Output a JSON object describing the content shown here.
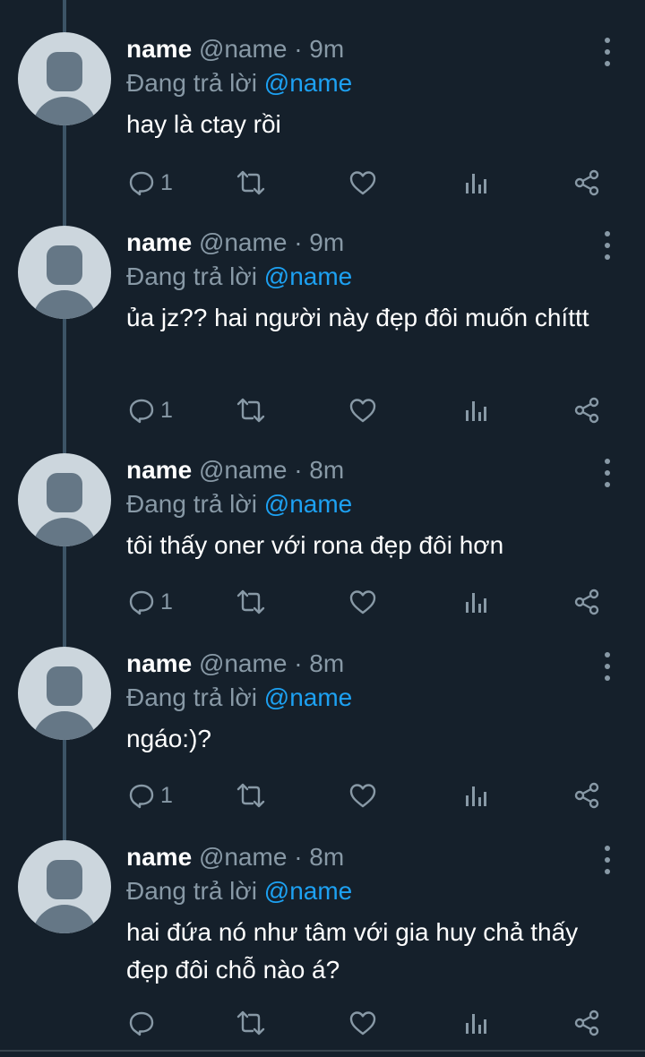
{
  "tweets": [
    {
      "display_name": "name",
      "handle": "@name",
      "separator": "·",
      "time": "9m",
      "reply_prefix": "Đang trả lời",
      "reply_to": "@name",
      "text": "hay là ctay rồi",
      "reply_count": "1",
      "icons": [
        "reply-icon",
        "retweet-icon",
        "like-icon",
        "analytics-icon",
        "share-icon",
        "more-icon"
      ]
    },
    {
      "display_name": "name",
      "handle": "@name",
      "separator": "·",
      "time": "9m",
      "reply_prefix": "Đang trả lời",
      "reply_to": "@name",
      "text": "ủa jz?? hai người này đẹp đôi muốn chíttt",
      "reply_count": "1"
    },
    {
      "display_name": "name",
      "handle": "@name",
      "separator": "·",
      "time": "8m",
      "reply_prefix": "Đang trả lời",
      "reply_to": "@name",
      "text": "tôi thấy oner với rona đẹp đôi hơn",
      "reply_count": "1"
    },
    {
      "display_name": "name",
      "handle": "@name",
      "separator": "·",
      "time": "8m",
      "reply_prefix": "Đang trả lời",
      "reply_to": "@name",
      "text": "ngáo:)?",
      "reply_count": "1"
    },
    {
      "display_name": "name",
      "handle": "@name",
      "separator": "·",
      "time": "8m",
      "reply_prefix": "Đang trả lời",
      "reply_to": "@name",
      "text": "hai đứa nó như tâm với gia huy chả thấy đẹp đôi chỗ nào á?",
      "reply_count": ""
    }
  ],
  "colors": {
    "background": "#15202b",
    "secondary_text": "#8899a6",
    "mention": "#1da1f2",
    "thread_line": "#3d5466"
  }
}
